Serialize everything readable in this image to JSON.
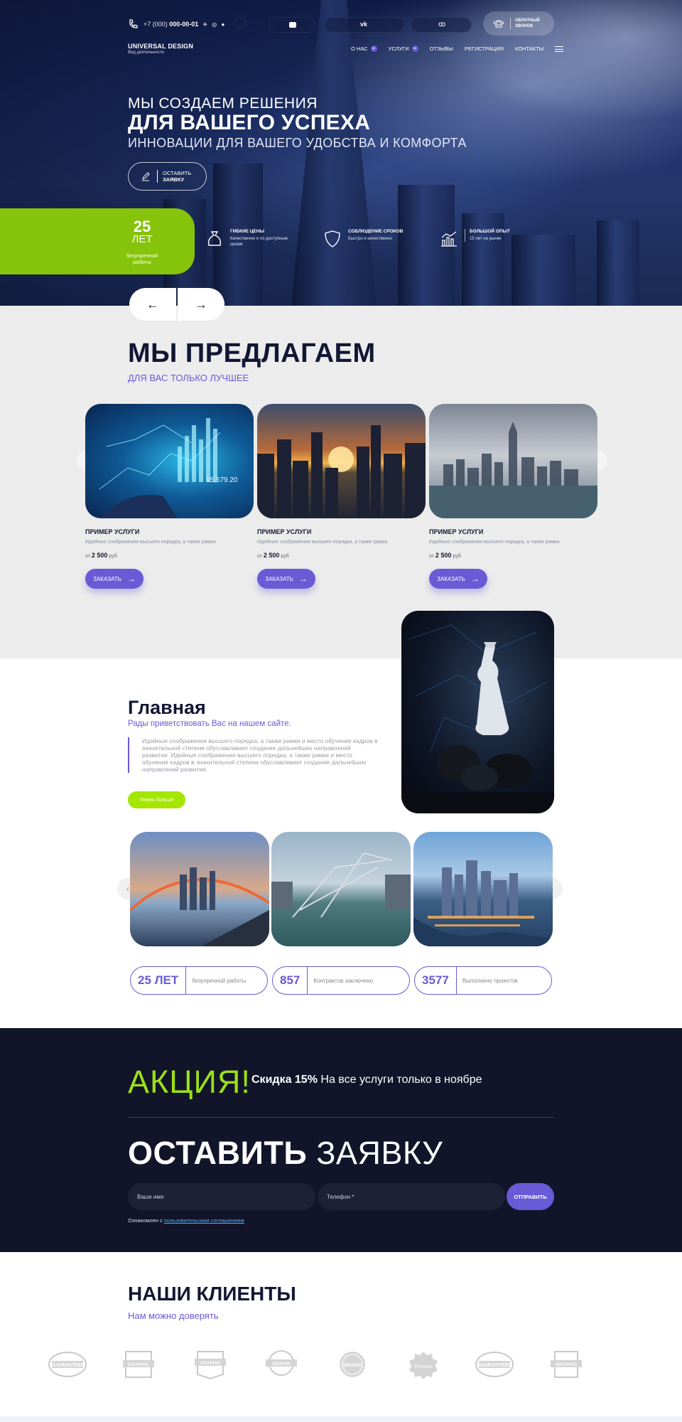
{
  "header": {
    "phone": "+7 (000) ",
    "phone_bold": "000-00-01",
    "callback": [
      "ОБРАТНЫЙ",
      "ЗВОНОК"
    ],
    "brand_name": "UNIVERSAL DESIGN",
    "brand_sub": "Вид деятельности",
    "nav": [
      {
        "label": "О НАС",
        "dropdown": true
      },
      {
        "label": "УСЛУГИ",
        "dropdown": true
      },
      {
        "label": "ОТЗЫВЫ"
      },
      {
        "label": "РЕГИСТРАЦИЯ"
      },
      {
        "label": "КОНТАКТЫ"
      }
    ]
  },
  "hero": {
    "line1": "МЫ СОЗДАЕМ РЕШЕНИЯ",
    "line2": "ДЛЯ ВАШЕГО УСПЕХА",
    "line3": "ИННОВАЦИИ ДЛЯ ВАШЕГО УДОБСТВА И КОМФОРТА",
    "cta": [
      "ОСТАВИТЬ",
      "ЗАЯВКУ"
    ],
    "years_num": "25",
    "years_unit": "ЛЕТ",
    "years_sub": "безупречной работы",
    "features": [
      {
        "title": "ГИБКИЕ ЦЕНЫ",
        "desc": "Качественно и по доступным ценам",
        "icon": "money-bag-icon"
      },
      {
        "title": "СОБЛЮДЕНИЕ СРОКОВ",
        "desc": "Быстро и качественно",
        "icon": "shield-icon"
      },
      {
        "title": "БОЛЬШОЙ ОПЫТ",
        "desc": "15 лет на рынке",
        "icon": "chart-icon"
      }
    ]
  },
  "offer": {
    "title": "МЫ ПРЕДЛАГАЕМ",
    "subtitle": "ДЛЯ ВАС ТОЛЬКО ЛУЧШЕЕ",
    "cards": [
      {
        "name": "ПРИМЕР УСЛУГИ",
        "desc": "Идейные соображения высшего порядка, а также рамки",
        "from": "от",
        "price": "2 500",
        "unit": "руб",
        "button": "ЗАКАЗАТЬ"
      },
      {
        "name": "ПРИМЕР УСЛУГИ",
        "desc": "Идейные соображения высшего порядка, а также рамки",
        "from": "от",
        "price": "2 500",
        "unit": "руб",
        "button": "ЗАКАЗАТЬ"
      },
      {
        "name": "ПРИМЕР УСЛУГИ",
        "desc": "Идейные соображения высшего порядка, а также рамки",
        "from": "от",
        "price": "2 500",
        "unit": "руб",
        "button": "ЗАКАЗАТЬ"
      }
    ]
  },
  "main": {
    "title": "Главная",
    "subtitle": "Рады приветствовать Вас на нашем сайте.",
    "text": "Идейные соображения высшего порядка, а также рамки и место обучения кадров в значительной степени обуславливает создание дальнейших направлений развития. Идейные соображения высшего порядка, а также рамки и место обучения кадров в значительной степени обуславливает создание дальнейших направлений развития.",
    "more": "Узнать больше",
    "stats": [
      {
        "num": "25 ЛЕТ",
        "label": "безупречной работы"
      },
      {
        "num": "857",
        "label": "Контрактов заключено"
      },
      {
        "num": "3577",
        "label": "Выполнено проектов"
      }
    ]
  },
  "promo": {
    "akcia": "АКЦИЯ!",
    "bold": "Скидка 15%",
    "text": " На все услуги только в ноябре",
    "form_bold": "ОСТАВИТЬ",
    "form_rest": " ЗАЯВКУ",
    "name_ph": "Ваше имя",
    "phone_ph": "Телефон *",
    "send": "ОТПРАВИТЬ",
    "agree": "Ознакомлен с ",
    "agree_link": "пользовательским соглашением"
  },
  "clients": {
    "title": "НАШИ КЛИЕНТЫ",
    "subtitle": "Нам можно доверять",
    "logos": [
      "GUARANTEED",
      "GRAPHIC",
      "GRAPHIC",
      "DESIGN",
      "GRAPHIC",
      "Premium",
      "GUARANTEED",
      "GRAPHIC"
    ]
  },
  "colors": {
    "accent": "#6a5ad6",
    "green": "#86c30b",
    "lime": "#9be118",
    "dark": "#12152a"
  }
}
